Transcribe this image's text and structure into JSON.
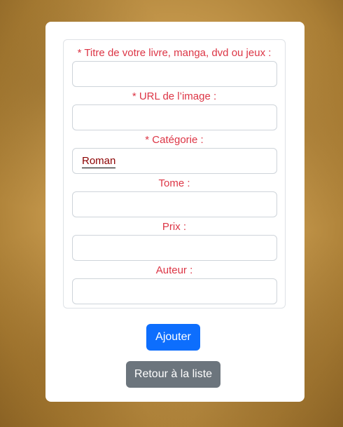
{
  "form": {
    "fields": [
      {
        "label": "* Titre de votre livre, manga, dvd ou jeux :",
        "value": ""
      },
      {
        "label": "* URL de l’image :",
        "value": ""
      },
      {
        "label": "* Catégorie :",
        "value": "Roman"
      },
      {
        "label": "Tome :",
        "value": ""
      },
      {
        "label": "Prix :",
        "value": ""
      },
      {
        "label": "Auteur :",
        "value": ""
      }
    ],
    "submit_label": "Ajouter",
    "back_label": "Retour à la liste"
  },
  "colors": {
    "label": "#dc3545",
    "primary": "#0d6efd",
    "secondary": "#6c757d"
  }
}
